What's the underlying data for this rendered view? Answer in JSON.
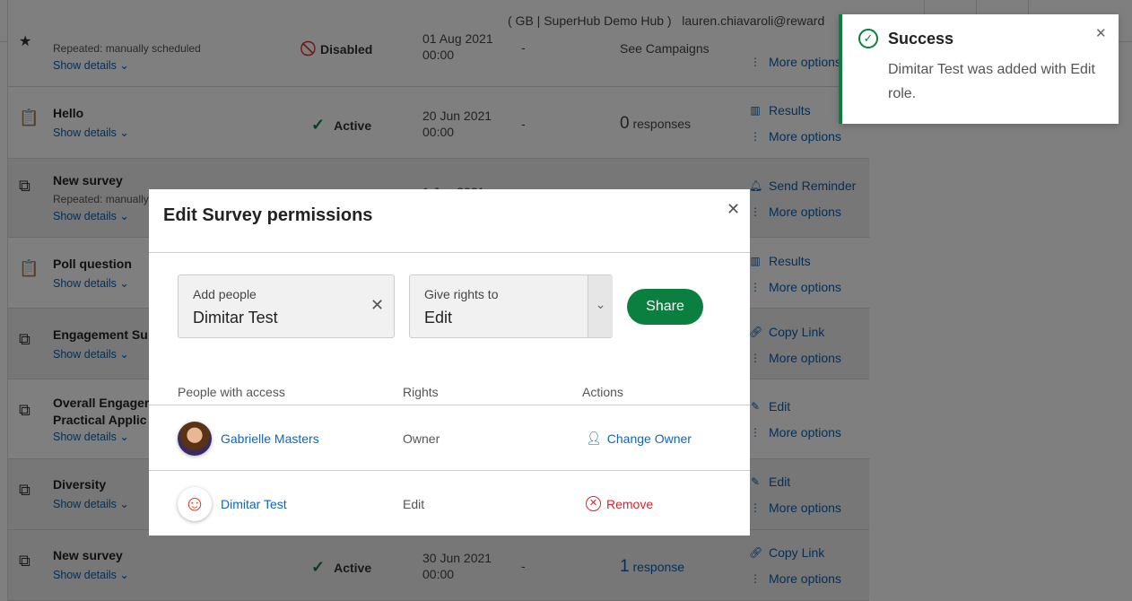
{
  "header": {
    "hub": "( GB | SuperHub Demo Hub )",
    "user": "lauren.chiavaroli@reward"
  },
  "rows": [
    {
      "name": "",
      "sub": "Repeated: manually scheduled",
      "show": "Show details",
      "status": "Disabled",
      "status_icon": "disabled-icon",
      "date": "01 Aug 2021",
      "time": "00:00",
      "dash": "-",
      "resp_num": "",
      "resp_text": "See Campaigns",
      "actions": [
        {
          "label": "More options",
          "icon": "more-icon"
        }
      ]
    },
    {
      "name": "Hello",
      "show": "Show details",
      "status": "Active",
      "status_icon": "check-icon",
      "date": "20 Jun 2021",
      "time": "00:00",
      "dash": "-",
      "resp_num": "0",
      "resp_text": "responses",
      "actions": [
        {
          "label": "Results",
          "icon": "chart-icon"
        },
        {
          "label": "More options",
          "icon": "more-icon"
        }
      ]
    },
    {
      "name": "New survey",
      "sub": "Repeated: manually",
      "show": "Show details",
      "date": "1 Jun 2021",
      "actions": [
        {
          "label": "Send Reminder",
          "icon": "bell-icon"
        },
        {
          "label": "More options",
          "icon": "more-icon"
        }
      ]
    },
    {
      "name": "Poll question",
      "show": "Show details",
      "actions": [
        {
          "label": "Results",
          "icon": "chart-icon"
        },
        {
          "label": "More options",
          "icon": "more-icon"
        }
      ]
    },
    {
      "name": "Engagement Su",
      "show": "Show details",
      "actions": [
        {
          "label": "Copy Link",
          "icon": "link-icon"
        },
        {
          "label": "More options",
          "icon": "more-icon"
        }
      ]
    },
    {
      "name": "Overall Engager",
      "name2": "Practical Applic",
      "show": "Show details",
      "actions": [
        {
          "label": "Edit",
          "icon": "pencil-icon"
        },
        {
          "label": "More options",
          "icon": "more-icon"
        }
      ]
    },
    {
      "name": "Diversity",
      "show": "Show details",
      "actions": [
        {
          "label": "Edit",
          "icon": "pencil-icon"
        },
        {
          "label": "More options",
          "icon": "more-icon"
        }
      ]
    },
    {
      "name": "New survey",
      "show": "Show details",
      "status": "Active",
      "date": "30 Jun 2021",
      "time": "00:00",
      "dash": "-",
      "resp_num": "1",
      "resp_text": "response",
      "actions": [
        {
          "label": "Copy Link",
          "icon": "link-icon"
        },
        {
          "label": "More options",
          "icon": "more-icon"
        }
      ]
    }
  ],
  "modal": {
    "title": "Edit Survey permissions",
    "add_people": {
      "label": "Add people",
      "value": "Dimitar Test"
    },
    "rights": {
      "label": "Give rights to",
      "value": "Edit"
    },
    "share": "Share",
    "columns": [
      "People with access",
      "Rights",
      "Actions"
    ],
    "people": [
      {
        "name": "Gabrielle Masters",
        "rights": "Owner",
        "action": "Change Owner",
        "action_icon": "user-icon"
      },
      {
        "name": "Dimitar Test",
        "rights": "Edit",
        "action": "Remove",
        "action_icon": "remove-circle-icon"
      }
    ]
  },
  "toast": {
    "title": "Success",
    "message": "Dimitar Test was added with Edit role."
  },
  "colors": {
    "accent": "#0b66c3",
    "success": "#0a7f3f",
    "danger": "#e0202d"
  }
}
